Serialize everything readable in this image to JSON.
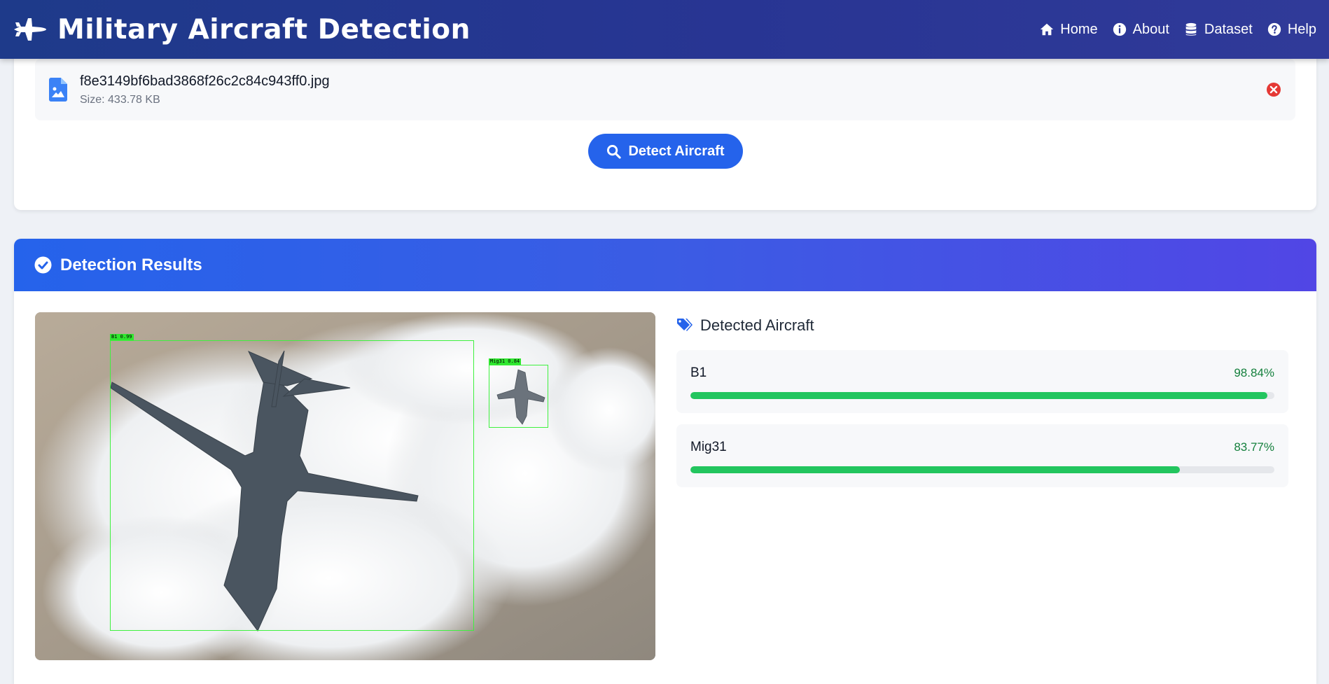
{
  "navbar": {
    "title": "Military Aircraft Detection",
    "brand_icon": "fighter-jet-icon",
    "links": [
      {
        "label": "Home",
        "icon": "home-icon"
      },
      {
        "label": "About",
        "icon": "info-icon"
      },
      {
        "label": "Dataset",
        "icon": "database-icon"
      },
      {
        "label": "Help",
        "icon": "help-icon"
      }
    ]
  },
  "upload": {
    "file_name": "f8e3149bf6bad3868f26c2c84c943ff0.jpg",
    "file_size": "Size: 433.78 KB",
    "file_icon": "file-image-icon",
    "remove_icon": "remove-circle-icon",
    "detect_button": "Detect Aircraft"
  },
  "results": {
    "title": "Detection Results",
    "detected_heading": "Detected Aircraft",
    "image_labels": [
      "B1 0.99",
      "Mig31 0.84"
    ],
    "detections": [
      {
        "name": "B1",
        "confidence_text": "98.84%",
        "confidence": 0.9884
      },
      {
        "name": "Mig31",
        "confidence_text": "83.77%",
        "confidence": 0.8377
      }
    ]
  },
  "colors": {
    "navbar": "#283593",
    "accent": "#2563eb",
    "header_end": "#5146e5",
    "confidence_bar": "#22c55e",
    "confidence_text": "#15803d",
    "remove": "#e53935",
    "bbox": "#3ef13e"
  }
}
